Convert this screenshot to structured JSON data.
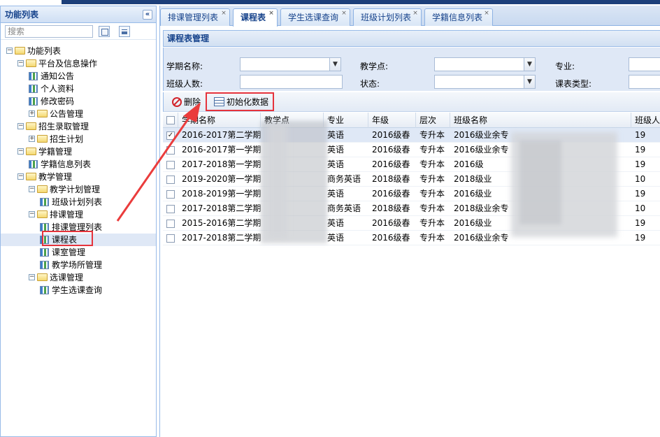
{
  "sidebar": {
    "title": "功能列表",
    "collapse_glyph": "«",
    "search_placeholder": "搜索",
    "tree": [
      {
        "label": "功能列表",
        "level": 0,
        "type": "folder",
        "expanded": true
      },
      {
        "label": "平台及信息操作",
        "level": 1,
        "type": "folder",
        "expanded": true
      },
      {
        "label": "通知公告",
        "level": 2,
        "type": "page"
      },
      {
        "label": "个人资料",
        "level": 2,
        "type": "page"
      },
      {
        "label": "修改密码",
        "level": 2,
        "type": "page"
      },
      {
        "label": "公告管理",
        "level": 2,
        "type": "folder",
        "expanded": false
      },
      {
        "label": "招生录取管理",
        "level": 1,
        "type": "folder",
        "expanded": true
      },
      {
        "label": "招生计划",
        "level": 2,
        "type": "folder",
        "expanded": false
      },
      {
        "label": "学籍管理",
        "level": 1,
        "type": "folder",
        "expanded": true
      },
      {
        "label": "学籍信息列表",
        "level": 2,
        "type": "page"
      },
      {
        "label": "教学管理",
        "level": 1,
        "type": "folder",
        "expanded": true
      },
      {
        "label": "教学计划管理",
        "level": 2,
        "type": "folder",
        "expanded": true
      },
      {
        "label": "班级计划列表",
        "level": 3,
        "type": "page"
      },
      {
        "label": "排课管理",
        "level": 2,
        "type": "folder",
        "expanded": true
      },
      {
        "label": "排课管理列表",
        "level": 3,
        "type": "page"
      },
      {
        "label": "课程表",
        "level": 3,
        "type": "page",
        "selected": true
      },
      {
        "label": "课室管理",
        "level": 3,
        "type": "page"
      },
      {
        "label": "教学场所管理",
        "level": 3,
        "type": "page"
      },
      {
        "label": "选课管理",
        "level": 2,
        "type": "folder",
        "expanded": true
      },
      {
        "label": "学生选课查询",
        "level": 3,
        "type": "page"
      }
    ]
  },
  "tabs": [
    {
      "label": "排课管理列表",
      "active": false
    },
    {
      "label": "课程表",
      "active": true
    },
    {
      "label": "学生选课查询",
      "active": false
    },
    {
      "label": "班级计划列表",
      "active": false
    },
    {
      "label": "学籍信息列表",
      "active": false
    }
  ],
  "tab_close_glyph": "×",
  "content": {
    "title": "课程表管理",
    "form": {
      "semester_label": "学期名称:",
      "site_label": "教学点:",
      "major_label": "专业:",
      "class_size_label": "班级人数:",
      "status_label": "状态:",
      "schedule_type_label": "课表类型:"
    },
    "toolbar": {
      "delete_label": "删除",
      "init_label": "初始化数据"
    },
    "grid": {
      "columns": [
        "学期名称",
        "教学点",
        "专业",
        "年级",
        "层次",
        "班级名称",
        "班级人"
      ],
      "rows": [
        {
          "semester": "2016-2017第二学期",
          "major": "英语",
          "grade": "2016级春",
          "level": "专升本",
          "class": "2016级业余专",
          "size": "19",
          "checked": true
        },
        {
          "semester": "2016-2017第一学期",
          "major": "英语",
          "grade": "2016级春",
          "level": "专升本",
          "class": "2016级业余专",
          "size": "19",
          "checked": false
        },
        {
          "semester": "2017-2018第一学期",
          "major": "英语",
          "grade": "2016级春",
          "level": "专升本",
          "class": "2016级",
          "size": "19",
          "checked": false
        },
        {
          "semester": "2019-2020第一学期",
          "major": "商务英语",
          "grade": "2018级春",
          "level": "专升本",
          "class": "2018级业",
          "size": "10",
          "checked": false
        },
        {
          "semester": "2018-2019第一学期",
          "major": "英语",
          "grade": "2016级春",
          "level": "专升本",
          "class": "2016级业",
          "size": "19",
          "checked": false
        },
        {
          "semester": "2017-2018第二学期",
          "major": "商务英语",
          "grade": "2018级春",
          "level": "专升本",
          "class": "2018级业余专",
          "size": "10",
          "checked": false
        },
        {
          "semester": "2015-2016第二学期",
          "major": "英语",
          "grade": "2016级春",
          "level": "专升本",
          "class": "2016级业",
          "size": "19",
          "checked": false
        },
        {
          "semester": "2017-2018第二学期",
          "major": "英语",
          "grade": "2016级春",
          "level": "专升本",
          "class": "2016级业余专",
          "size": "19",
          "checked": false
        }
      ]
    }
  },
  "colors": {
    "accent": "#15428b",
    "border": "#99bbe8",
    "selected_row": "#dfe8f6",
    "annotation_red": "#e5333c"
  },
  "icons": {
    "check_glyph": "✓",
    "select_arrow_glyph": "▼"
  }
}
